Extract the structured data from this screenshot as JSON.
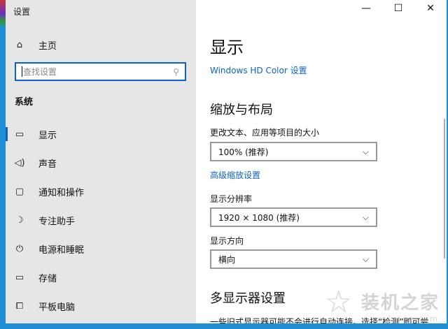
{
  "window": {
    "title": "设置",
    "controls": [
      "—",
      "☐",
      "✕"
    ]
  },
  "sidebar": {
    "home": "主页",
    "search_placeholder": "查找设置",
    "section": "系统",
    "items": [
      {
        "icon": "monitor-icon",
        "label": "显示"
      },
      {
        "icon": "speaker-icon",
        "label": "声音"
      },
      {
        "icon": "notification-icon",
        "label": "通知和操作"
      },
      {
        "icon": "moon-icon",
        "label": "专注助手"
      },
      {
        "icon": "power-icon",
        "label": "电源和睡眠"
      },
      {
        "icon": "storage-icon",
        "label": "存储"
      },
      {
        "icon": "tablet-icon",
        "label": "平板电脑"
      }
    ]
  },
  "main": {
    "title": "显示",
    "hdr_link": "Windows HD Color 设置",
    "scale_heading": "缩放与布局",
    "scale_label": "更改文本、应用等项目的大小",
    "scale_value": "100% (推荐)",
    "advanced_scale_link": "高级缩放设置",
    "resolution_label": "显示分辨率",
    "resolution_value": "1920 × 1080 (推荐)",
    "orientation_label": "显示方向",
    "orientation_value": "横向",
    "multi_heading": "多显示器设置",
    "multi_text": "一些旧式显示器可能不会进行自动连接。选择“检测”即可尝"
  },
  "watermark": {
    "title": "装机之家",
    "url": "www.lotpc.com"
  }
}
